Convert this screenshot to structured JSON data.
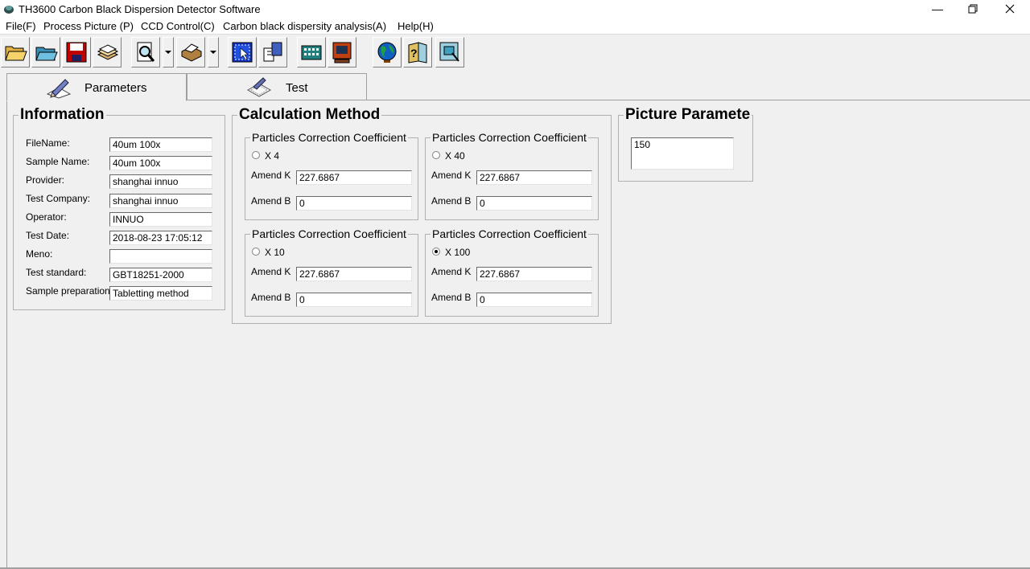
{
  "window": {
    "title": "TH3600 Carbon Black Dispersion Detector Software"
  },
  "menu": [
    "File(F)",
    "Process Picture (P)",
    "CCD Control(C)",
    "Carbon black dispersity analysis(A)",
    "Help(H)"
  ],
  "toolbar": [
    "open-folder-icon",
    "open-file-icon",
    "save-disk-icon",
    "print-stack-icon",
    "print-preview-icon",
    "printer-icon",
    "select-window-icon",
    "document-copy-icon",
    "calculator-icon",
    "monitor-icon",
    "globe-icon",
    "help-icon",
    "help-monitor-icon"
  ],
  "tabs": {
    "parameters": "Parameters",
    "test": "Test"
  },
  "information": {
    "title": "Information",
    "fields": [
      {
        "label": "FileName:",
        "value": "40um 100x"
      },
      {
        "label": "Sample Name:",
        "value": "40um 100x"
      },
      {
        "label": "Provider:",
        "value": " shanghai innuo"
      },
      {
        "label": "Test Company:",
        "value": "  shanghai innuo"
      },
      {
        "label": "Operator:",
        "value": " INNUO"
      },
      {
        "label": "Test Date:",
        "value": "2018-08-23 17:05:12"
      },
      {
        "label": "Meno:",
        "value": ""
      },
      {
        "label": "Test standard:",
        "value": "GBT18251-2000"
      },
      {
        "label": "Sample preparation:",
        "value": "Tabletting method"
      }
    ]
  },
  "calculation": {
    "title": "Calculation Method",
    "boxes": [
      {
        "title": "Particles Correction Coefficient",
        "option": "X 4",
        "selected": false,
        "k_label": "Amend K",
        "k": "227.6867",
        "b_label": "Amend B",
        "b": "0"
      },
      {
        "title": "Particles Correction Coefficient",
        "option": "X 40",
        "selected": false,
        "k_label": "Amend K",
        "k": "227.6867",
        "b_label": "Amend B",
        "b": "0"
      },
      {
        "title": "Particles Correction Coefficient",
        "option": "X 10",
        "selected": false,
        "k_label": "Amend K",
        "k": "227.6867",
        "b_label": "Amend B",
        "b": "0"
      },
      {
        "title": "Particles Correction Coefficient",
        "option": "X 100",
        "selected": true,
        "k_label": "Amend K",
        "k": "227.6867",
        "b_label": "Amend B",
        "b": "0"
      }
    ]
  },
  "picture": {
    "title": "Picture Paramete",
    "value": "150"
  },
  "colors": {
    "window_bg": "#f0f0f0",
    "field_bg": "#ffffff",
    "group_border": "#b0b0b0"
  }
}
